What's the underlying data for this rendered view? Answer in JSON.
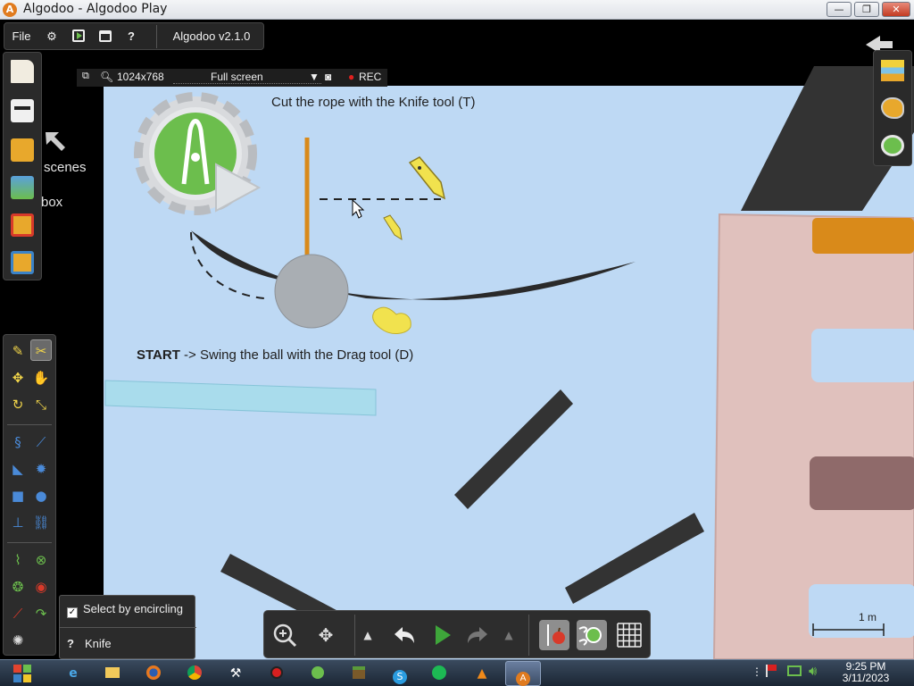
{
  "window": {
    "title": "Algodoo - Algodoo Play",
    "controls": {
      "minimize": "—",
      "maximize": "❐",
      "close": "✕"
    }
  },
  "menubar": {
    "file": "File",
    "gear_icon": "settings",
    "play_icon": "play-scene",
    "window_icon": "window",
    "help": "?",
    "version": "Algodoo v2.1.0"
  },
  "recbar": {
    "resolution": "1024x768",
    "mode": "Full screen",
    "rec": "REC"
  },
  "sidebar_labels": {
    "scenes": "scenes",
    "box": "box"
  },
  "scene": {
    "instruction_top": "Cut the rope with the Knife tool (T)",
    "instruction_start_bold": "START",
    "instruction_start_rest": " -> Swing the ball with the Drag tool (D)",
    "scale_label": "1 m",
    "colors": {
      "sky": "#bed9f4",
      "rope": "#d98a1a",
      "ball": "#a9aeb3",
      "building": "#e0c1bd",
      "dark_beam": "#333333",
      "glass": "#a9dcec"
    }
  },
  "popup": {
    "select_by_encircling": "Select by encircling",
    "help_mark": "?",
    "tool_name": "Knife"
  },
  "bottombar": {
    "zoom_icon": "zoom-icon",
    "pan_icon": "move-icon",
    "undo_icon": "undo-icon",
    "play_icon": "play-icon",
    "redo_icon": "redo-icon"
  },
  "taskbar": {
    "time": "9:25 PM",
    "date": "3/11/2023"
  }
}
